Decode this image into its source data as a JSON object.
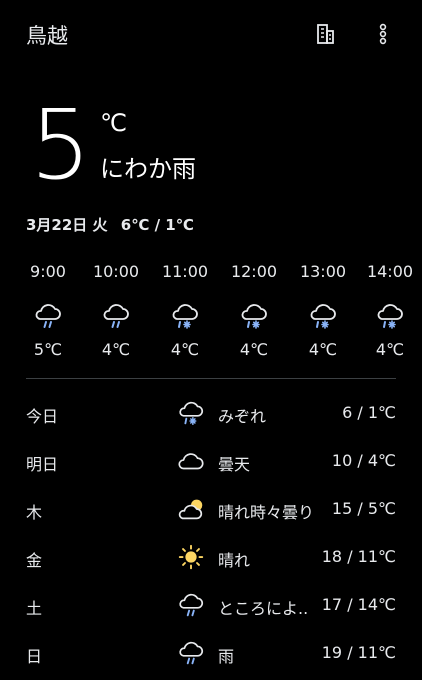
{
  "header": {
    "city": "鳥越",
    "building_icon": "building-icon",
    "more_icon": "more-vert-icon"
  },
  "current": {
    "temp": "5",
    "unit": "℃",
    "condition": "にわか雨"
  },
  "date_line": {
    "date": "3月22日 火",
    "high_low": "6℃ / 1℃"
  },
  "hourly": [
    {
      "time": "9:00",
      "icon": "rain-cloud-icon",
      "temp": "5℃"
    },
    {
      "time": "10:00",
      "icon": "rain-cloud-icon",
      "temp": "4℃"
    },
    {
      "time": "11:00",
      "icon": "sleet-cloud-icon",
      "temp": "4℃"
    },
    {
      "time": "12:00",
      "icon": "sleet-cloud-icon",
      "temp": "4℃"
    },
    {
      "time": "13:00",
      "icon": "sleet-cloud-icon",
      "temp": "4℃"
    },
    {
      "time": "14:00",
      "icon": "sleet-cloud-icon",
      "temp": "4℃"
    }
  ],
  "daily": [
    {
      "day": "今日",
      "icon": "sleet-cloud-icon",
      "condition": "みぞれ",
      "temps": "6 / 1℃"
    },
    {
      "day": "明日",
      "icon": "cloud-icon",
      "condition": "曇天",
      "temps": "10 / 4℃"
    },
    {
      "day": "木",
      "icon": "partly-cloudy-icon",
      "condition": "晴れ時々曇り",
      "temps": "15 / 5℃"
    },
    {
      "day": "金",
      "icon": "sun-icon",
      "condition": "晴れ",
      "temps": "18 / 11℃"
    },
    {
      "day": "土",
      "icon": "rain-cloud-icon",
      "condition": "ところによ..",
      "temps": "17 / 14℃"
    },
    {
      "day": "日",
      "icon": "rain-cloud-icon",
      "condition": "雨",
      "temps": "19 / 11℃"
    }
  ],
  "colors": {
    "background": "#000000",
    "text": "#e8eaed",
    "rain": "#8ab4f8",
    "sun": "#fdd663"
  }
}
